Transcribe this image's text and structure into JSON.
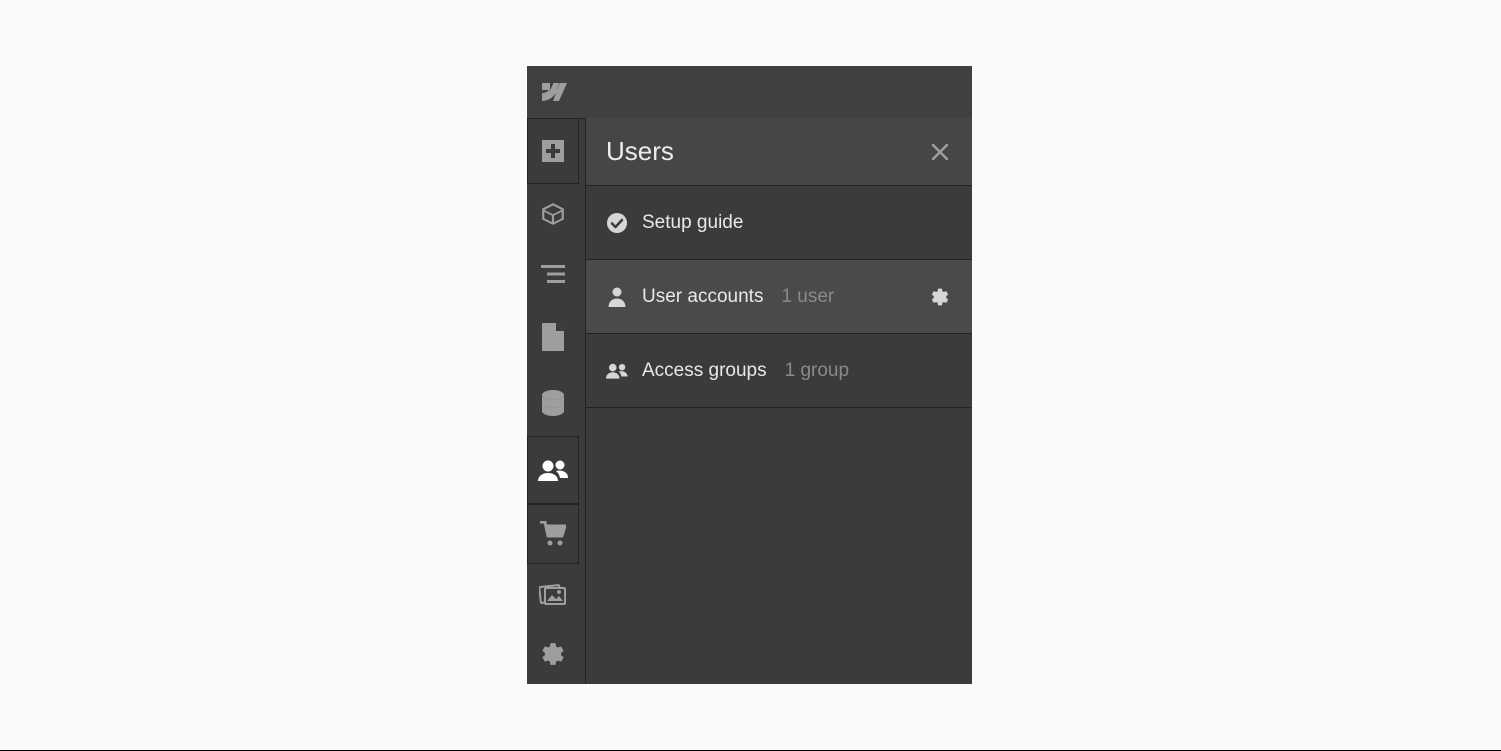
{
  "panel": {
    "title": "Users",
    "items": [
      {
        "label": "Setup guide",
        "count": ""
      },
      {
        "label": "User accounts",
        "count": "1 user"
      },
      {
        "label": "Access groups",
        "count": "1 group"
      }
    ]
  }
}
